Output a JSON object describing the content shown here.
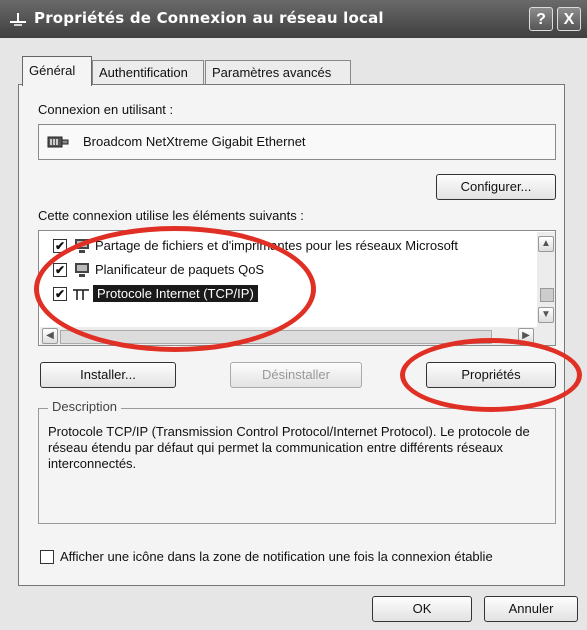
{
  "window": {
    "title": "Propriétés de Connexion au réseau local",
    "help_label": "?",
    "close_label": "X"
  },
  "tabs": [
    "Général",
    "Authentification",
    "Paramètres avancés"
  ],
  "general": {
    "connect_using_label": "Connexion en utilisant :",
    "adapter_name": "Broadcom NetXtreme Gigabit Ethernet",
    "configure_label": "Configurer...",
    "items_label": "Cette connexion utilise les éléments suivants :",
    "items": [
      {
        "label": "Partage de fichiers et d'imprimantes pour les réseaux Microsoft",
        "checked": true,
        "selected": false
      },
      {
        "label": "Planificateur de paquets QoS",
        "checked": true,
        "selected": false
      },
      {
        "label": "Protocole Internet (TCP/IP)",
        "checked": true,
        "selected": true
      }
    ],
    "install_label": "Installer...",
    "uninstall_label": "Désinstaller",
    "properties_label": "Propriétés",
    "description_title": "Description",
    "description_text": "Protocole TCP/IP (Transmission Control Protocol/Internet Protocol). Le protocole de réseau étendu par défaut qui permet la communication entre différents réseaux interconnectés.",
    "show_icon_label": "Afficher une icône dans la zone de notification une fois la connexion établie",
    "show_icon_checked": false
  },
  "footer": {
    "ok_label": "OK",
    "cancel_label": "Annuler"
  },
  "colors": {
    "annotation": "#e03026",
    "selection": "#1a1a1a"
  }
}
